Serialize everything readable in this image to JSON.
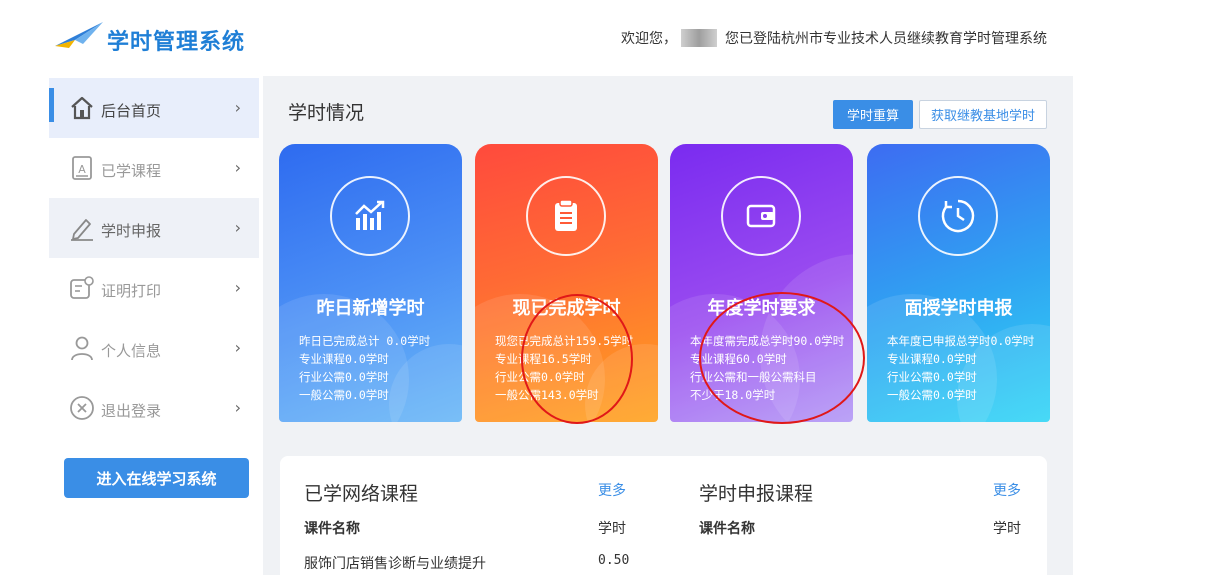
{
  "app": {
    "logo_text": "学时管理系统"
  },
  "sidebar": {
    "items": [
      {
        "label": "后台首页",
        "icon": "home-icon"
      },
      {
        "label": "已学课程",
        "icon": "document-icon"
      },
      {
        "label": "学时申报",
        "icon": "pen-icon"
      },
      {
        "label": "证明打印",
        "icon": "certificate-icon"
      },
      {
        "label": "个人信息",
        "icon": "user-icon"
      },
      {
        "label": "退出登录",
        "icon": "exit-icon"
      }
    ],
    "enter_button": "进入在线学习系统"
  },
  "header": {
    "welcome_prefix": "欢迎您，",
    "welcome_suffix": "您已登陆杭州市专业技术人员继续教育学时管理系统"
  },
  "section": {
    "title": "学时情况",
    "recalc_button": "学时重算",
    "fetch_button": "获取继教基地学时"
  },
  "cards": [
    {
      "title": "昨日新增学时",
      "icon": "trend-chart-icon",
      "lines": [
        "昨日已完成总计 0.0学时",
        "专业课程0.0学时",
        "行业公需0.0学时",
        "一般公需0.0学时"
      ]
    },
    {
      "title": "现已完成学时",
      "icon": "clipboard-icon",
      "lines": [
        "现您已完成总计159.5学时",
        "专业课程16.5学时",
        "行业公需0.0学时",
        "一般公需143.0学时"
      ]
    },
    {
      "title": "年度学时要求",
      "icon": "wallet-icon",
      "lines": [
        "本年度需完成总学时90.0学时",
        "专业课程60.0学时",
        "行业公需和一般公需科目",
        "不少于18.0学时"
      ]
    },
    {
      "title": "面授学时申报",
      "icon": "clock-icon",
      "lines": [
        "本年度已申报总学时0.0学时",
        "专业课程0.0学时",
        "行业公需0.0学时",
        "一般公需0.0学时"
      ]
    }
  ],
  "learned_courses": {
    "title": "已学网络课程",
    "more": "更多",
    "col_name": "课件名称",
    "col_hours": "学时",
    "rows": [
      {
        "name": "服饰门店销售诊断与业绩提升",
        "hours": "0.50"
      }
    ]
  },
  "declared_courses": {
    "title": "学时申报课程",
    "more": "更多",
    "col_name": "课件名称",
    "col_hours": "学时"
  },
  "colors": {
    "accent": "#3a8ee6",
    "annotation": "#e01818"
  }
}
